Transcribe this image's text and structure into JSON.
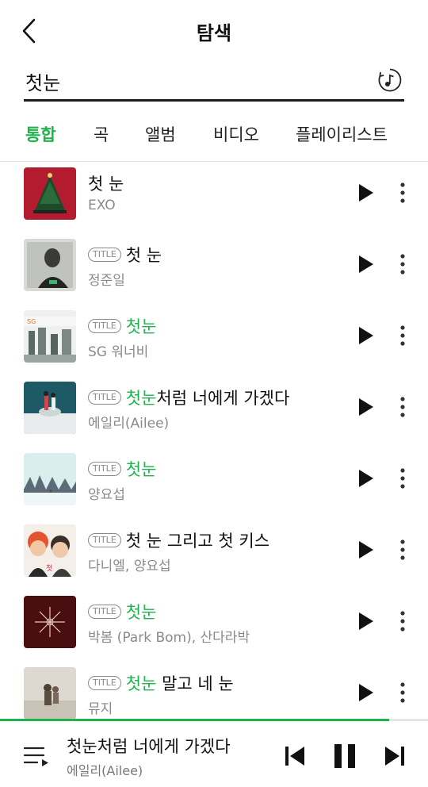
{
  "header": {
    "title": "탐색",
    "back_icon": "chevron-left-icon"
  },
  "search": {
    "value": "첫눈",
    "icon": "music-search-icon"
  },
  "tabs": [
    {
      "label": "통합",
      "active": true
    },
    {
      "label": "곡",
      "active": false
    },
    {
      "label": "앨범",
      "active": false
    },
    {
      "label": "비디오",
      "active": false
    },
    {
      "label": "플레이리스트",
      "active": false
    }
  ],
  "results": [
    {
      "badge": "",
      "title_highlight": "",
      "title_rest": "첫 눈",
      "artist": "EXO"
    },
    {
      "badge": "TITLE",
      "title_highlight": "",
      "title_rest": "첫 눈",
      "artist": "정준일"
    },
    {
      "badge": "TITLE",
      "title_highlight": "첫눈",
      "title_rest": "",
      "artist": "SG 워너비"
    },
    {
      "badge": "TITLE",
      "title_highlight": "첫눈",
      "title_rest": "처럼 너에게 가겠다",
      "artist": "에일리(Ailee)"
    },
    {
      "badge": "TITLE",
      "title_highlight": "첫눈",
      "title_rest": "",
      "artist": "양요섭"
    },
    {
      "badge": "TITLE",
      "title_highlight": "",
      "title_rest": "첫 눈 그리고 첫 키스",
      "artist": "다니엘, 양요섭"
    },
    {
      "badge": "TITLE",
      "title_highlight": "첫눈",
      "title_rest": "",
      "artist": "박봄 (Park Bom), 산다라박"
    },
    {
      "badge": "TITLE",
      "title_highlight": "첫눈",
      "title_rest": " 말고 네 눈",
      "artist": "뮤지"
    }
  ],
  "now_playing": {
    "title": "첫눈처럼 너에게 가겠다",
    "artist": "에일리(Ailee)",
    "progress": 0.91
  },
  "colors": {
    "accent": "#1fb34d",
    "text": "#111111",
    "muted": "#8a8a8a"
  }
}
